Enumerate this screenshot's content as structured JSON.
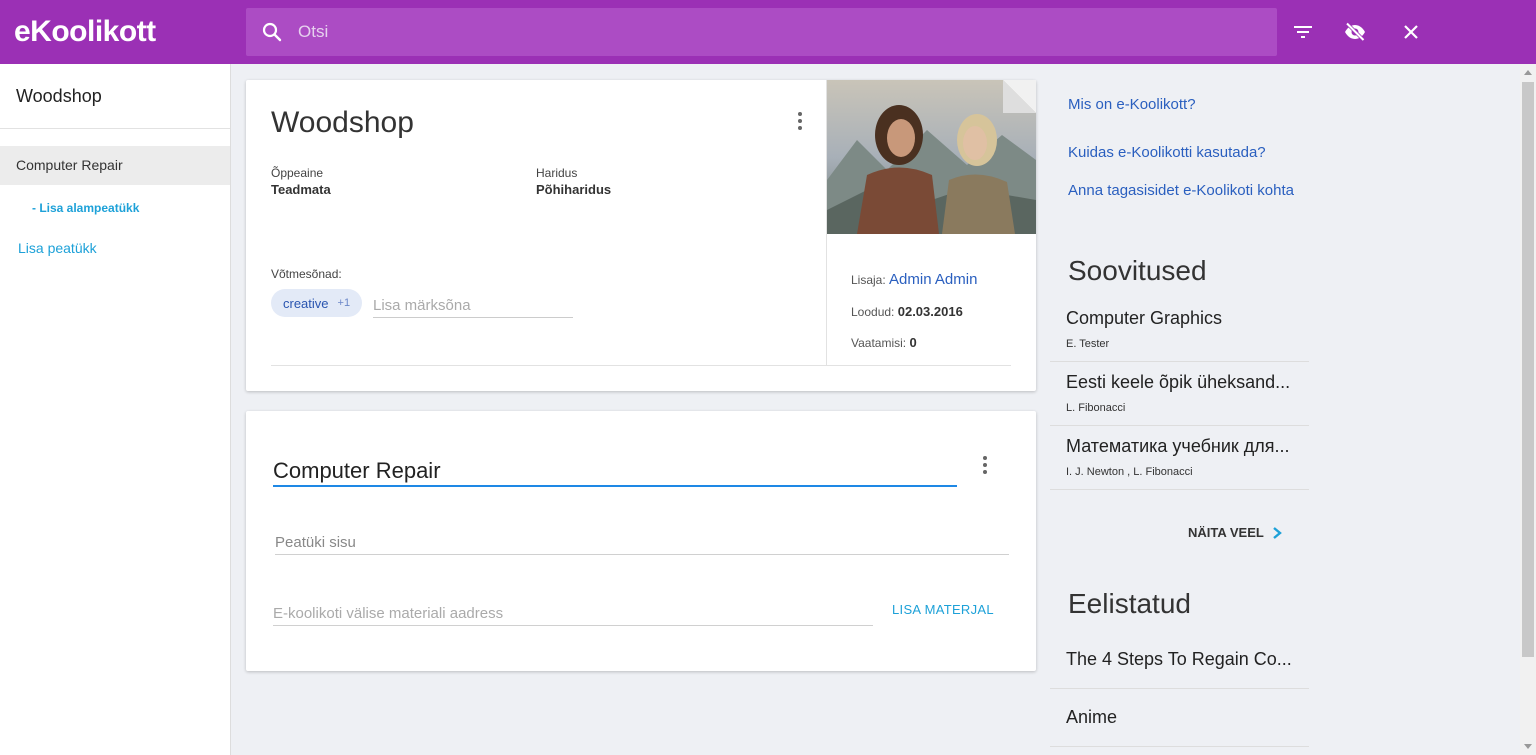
{
  "header": {
    "logo_text": "eKoolikott",
    "search_placeholder": "Otsi"
  },
  "sidebar": {
    "title": "Woodshop",
    "chapters": [
      {
        "label": "Computer Repair",
        "active": true
      }
    ],
    "add_subchapter": "- Lisa alampeatükk",
    "add_chapter": "Lisa peatükk"
  },
  "material": {
    "title": "Woodshop",
    "subject_label": "Õppeaine",
    "subject_value": "Teadmata",
    "education_label": "Haridus",
    "education_value": "Põhiharidus",
    "keywords_label": "Võtmesõnad:",
    "keyword_chip": "creative",
    "keyword_extra": "+1",
    "keyword_placeholder": "Lisa märksõna",
    "author_label": "Lisaja:",
    "author_value": "Admin Admin",
    "created_label": "Loodud:",
    "created_value": "02.03.2016",
    "views_label": "Vaatamisi:",
    "views_value": "0"
  },
  "chapter": {
    "title": "Computer Repair",
    "content_placeholder": "Peatüki sisu",
    "url_placeholder": "E-koolikoti välise materiali aadress",
    "add_material": "LISA MATERJAL"
  },
  "right": {
    "links": [
      "Mis on e-Koolikott?",
      "Kuidas e-Koolikotti kasutada?",
      "Anna tagasisidet e-Koolikoti kohta"
    ],
    "recommendations_title": "Soovitused",
    "recommendations": [
      {
        "title": "Computer Graphics",
        "authors": "E. Tester"
      },
      {
        "title": "Eesti keele õpik üheksand...",
        "authors": "L. Fibonacci"
      },
      {
        "title": "Математика учебник для...",
        "authors": "I. J. Newton , L. Fibonacci"
      }
    ],
    "show_more": "NÄITA VEEL",
    "favorites_title": "Eelistatud",
    "favorites": [
      "The 4 Steps To Regain Co...",
      "Anime"
    ]
  },
  "colors": {
    "brand": "#9b30b5",
    "accent": "#1da1d8",
    "link": "#2a5fbf"
  }
}
